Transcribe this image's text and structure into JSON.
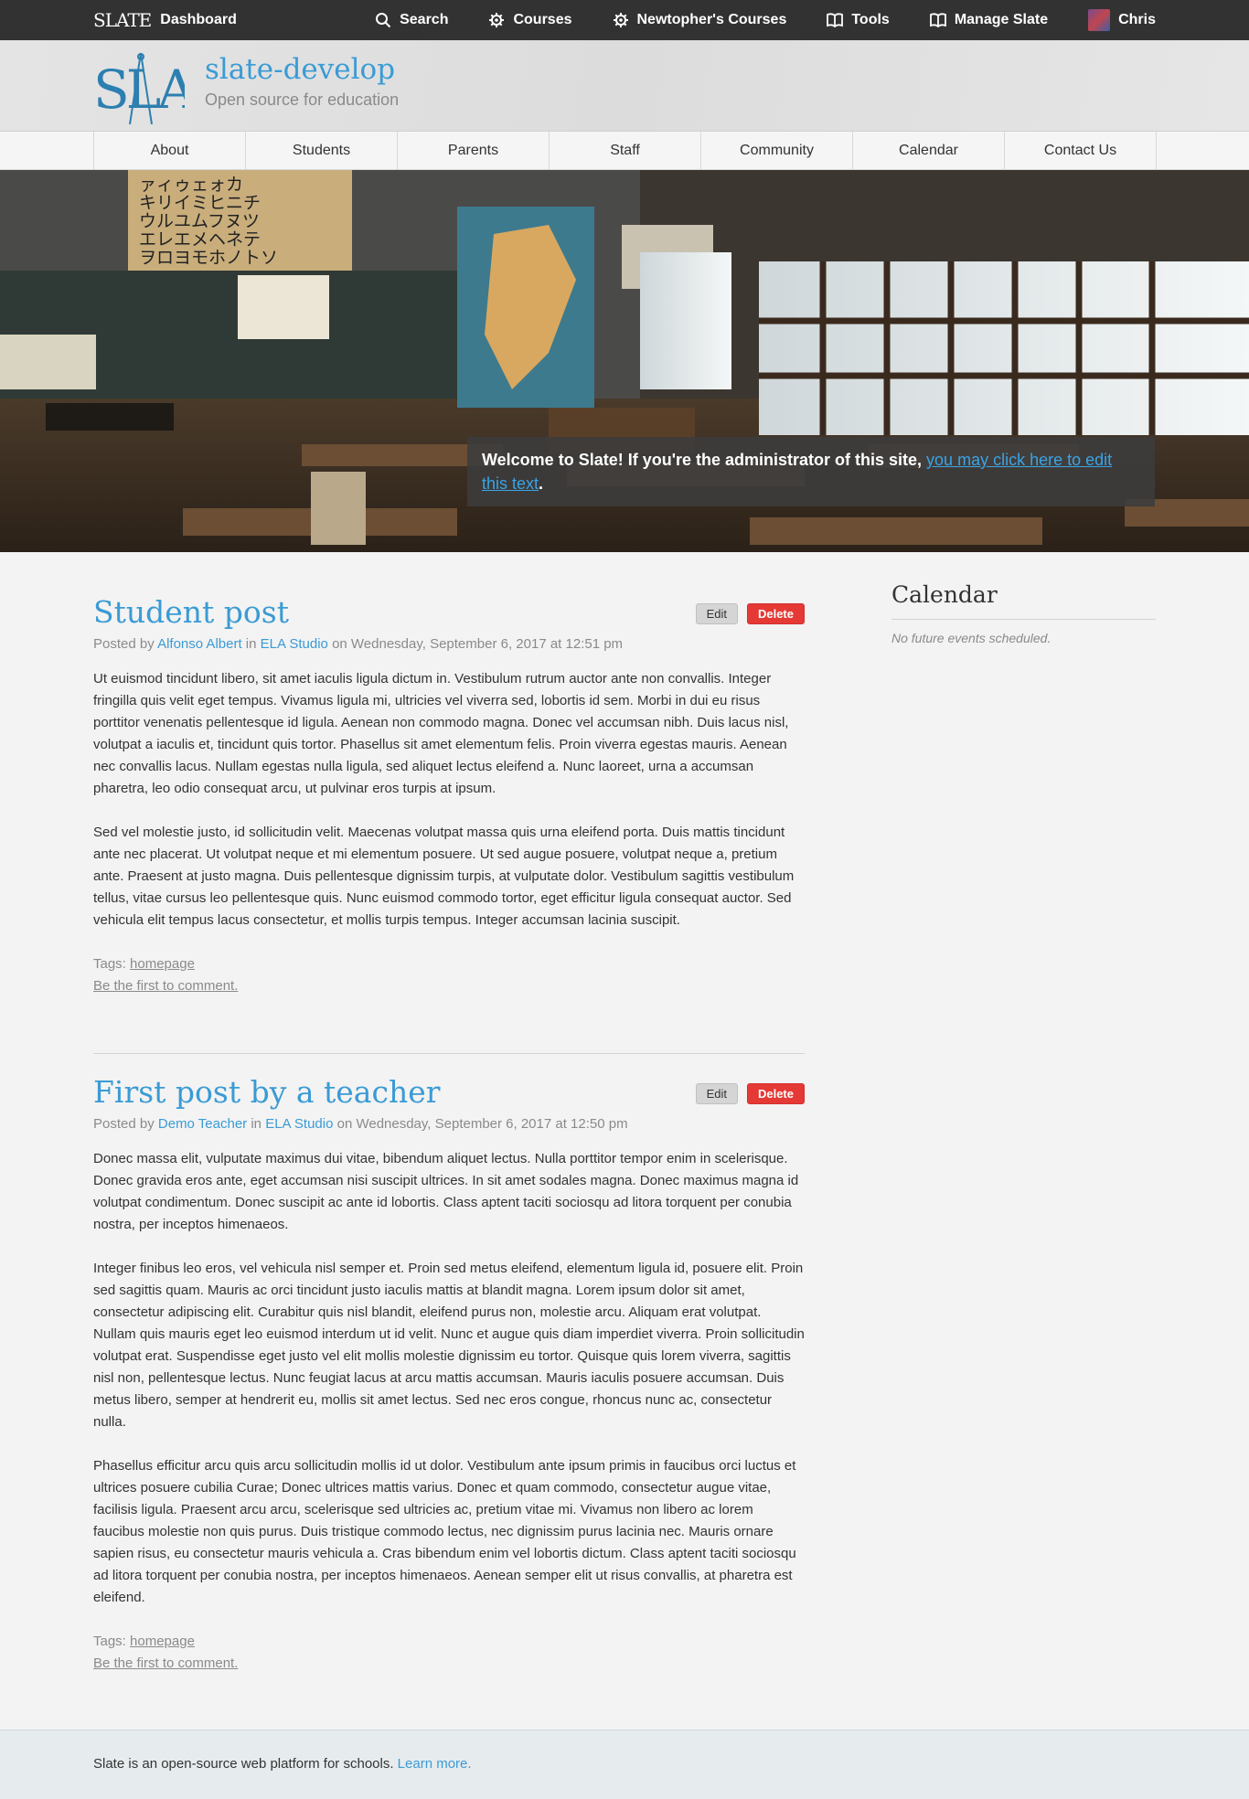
{
  "topbar": {
    "brand_logo": "SLATE",
    "dashboard": "Dashboard",
    "nav": [
      {
        "label": "Search",
        "icon": "search-icon"
      },
      {
        "label": "Courses",
        "icon": "gear-icon"
      },
      {
        "label": "Newtopher's Courses",
        "icon": "gear-icon"
      },
      {
        "label": "Tools",
        "icon": "book-icon"
      },
      {
        "label": "Manage Slate",
        "icon": "book-icon"
      },
      {
        "label": "Chris",
        "icon": "avatar"
      }
    ]
  },
  "header": {
    "logo_text": "SLATE",
    "site_name": "slate-develop",
    "tagline": "Open source for education"
  },
  "mainnav": [
    "About",
    "Students",
    "Parents",
    "Staff",
    "Community",
    "Calendar",
    "Contact Us"
  ],
  "hero": {
    "welcome_text": "Welcome to Slate! If you're the administrator of this site, ",
    "welcome_link": "you may click here to edit this text",
    "welcome_end": ".",
    "sign_lines": [
      "ァィゥェォカ",
      "キリイミヒニチ",
      "ウルユムフヌツ",
      "エレエメヘネテ",
      "ヲロヨモホノトソ"
    ]
  },
  "posts": [
    {
      "title": "Student post",
      "posted_by": "Posted by",
      "author": "Alfonso Albert",
      "in": "in",
      "group": "ELA Studio",
      "date": "on Wednesday, September 6, 2017 at 12:51 pm",
      "edit": "Edit",
      "delete": "Delete",
      "paragraphs": [
        "Ut euismod tincidunt libero, sit amet iaculis ligula dictum in. Vestibulum rutrum auctor ante non convallis. Integer fringilla quis velit eget tempus. Vivamus ligula mi, ultricies vel viverra sed, lobortis id sem. Morbi in dui eu risus porttitor venenatis pellentesque id ligula. Aenean non commodo magna. Donec vel accumsan nibh. Duis lacus nisl, volutpat a iaculis et, tincidunt quis tortor. Phasellus sit amet elementum felis. Proin viverra egestas mauris. Aenean nec convallis lacus. Nullam egestas nulla ligula, sed aliquet lectus eleifend a. Nunc laoreet, urna a accumsan pharetra, leo odio consequat arcu, ut pulvinar eros turpis at ipsum.",
        "Sed vel molestie justo, id sollicitudin velit. Maecenas volutpat massa quis urna eleifend porta. Duis mattis tincidunt ante nec placerat. Ut volutpat neque et mi elementum posuere. Ut sed augue posuere, volutpat neque a, pretium ante. Praesent at justo magna. Duis pellentesque dignissim turpis, at vulputate dolor. Vestibulum sagittis vestibulum tellus, vitae cursus leo pellentesque quis. Nunc euismod commodo tortor, eget efficitur ligula consequat auctor. Sed vehicula elit tempus lacus consectetur, et mollis turpis tempus. Integer accumsan lacinia suscipit."
      ],
      "tags_label": "Tags:",
      "tag": "homepage",
      "comment": "Be the first to comment."
    },
    {
      "title": "First post by a teacher",
      "posted_by": "Posted by",
      "author": "Demo Teacher",
      "in": "in",
      "group": "ELA Studio",
      "date": "on Wednesday, September 6, 2017 at 12:50 pm",
      "edit": "Edit",
      "delete": "Delete",
      "paragraphs": [
        "Donec massa elit, vulputate maximus dui vitae, bibendum aliquet lectus. Nulla porttitor tempor enim in scelerisque. Donec gravida eros ante, eget accumsan nisi suscipit ultrices. In sit amet sodales magna. Donec maximus magna id volutpat condimentum. Donec suscipit ac ante id lobortis. Class aptent taciti sociosqu ad litora torquent per conubia nostra, per inceptos himenaeos.",
        "Integer finibus leo eros, vel vehicula nisl semper et. Proin sed metus eleifend, elementum ligula id, posuere elit. Proin sed sagittis quam. Mauris ac orci tincidunt justo iaculis mattis at blandit magna. Lorem ipsum dolor sit amet, consectetur adipiscing elit. Curabitur quis nisl blandit, eleifend purus non, molestie arcu. Aliquam erat volutpat. Nullam quis mauris eget leo euismod interdum ut id velit. Nunc et augue quis diam imperdiet viverra. Proin sollicitudin volutpat erat. Suspendisse eget justo vel elit mollis molestie dignissim eu tortor. Quisque quis lorem viverra, sagittis nisl non, pellentesque lectus. Nunc feugiat lacus at arcu mattis accumsan. Mauris iaculis posuere accumsan. Duis metus libero, semper at hendrerit eu, mollis sit amet lectus. Sed nec eros congue, rhoncus nunc ac, consectetur nulla.",
        "Phasellus efficitur arcu quis arcu sollicitudin mollis id ut dolor. Vestibulum ante ipsum primis in faucibus orci luctus et ultrices posuere cubilia Curae; Donec ultrices mattis varius. Donec et quam commodo, consectetur augue vitae, facilisis ligula. Praesent arcu arcu, scelerisque sed ultricies ac, pretium vitae mi. Vivamus non libero ac lorem faucibus molestie non quis purus. Duis tristique commodo lectus, nec dignissim purus lacinia nec. Mauris ornare sapien risus, eu consectetur mauris vehicula a. Cras bibendum enim vel lobortis dictum. Class aptent taciti sociosqu ad litora torquent per conubia nostra, per inceptos himenaeos. Aenean semper elit ut risus convallis, at pharetra est eleifend."
      ],
      "tags_label": "Tags:",
      "tag": "homepage",
      "comment": "Be the first to comment."
    }
  ],
  "sidebar": {
    "title": "Calendar",
    "empty": "No future events scheduled."
  },
  "footer": {
    "text": "Slate is an open-source web platform for schools. ",
    "link": "Learn more."
  },
  "colors": {
    "accent": "#3a9bd5",
    "topbar": "#323232",
    "delete": "#e53935"
  }
}
